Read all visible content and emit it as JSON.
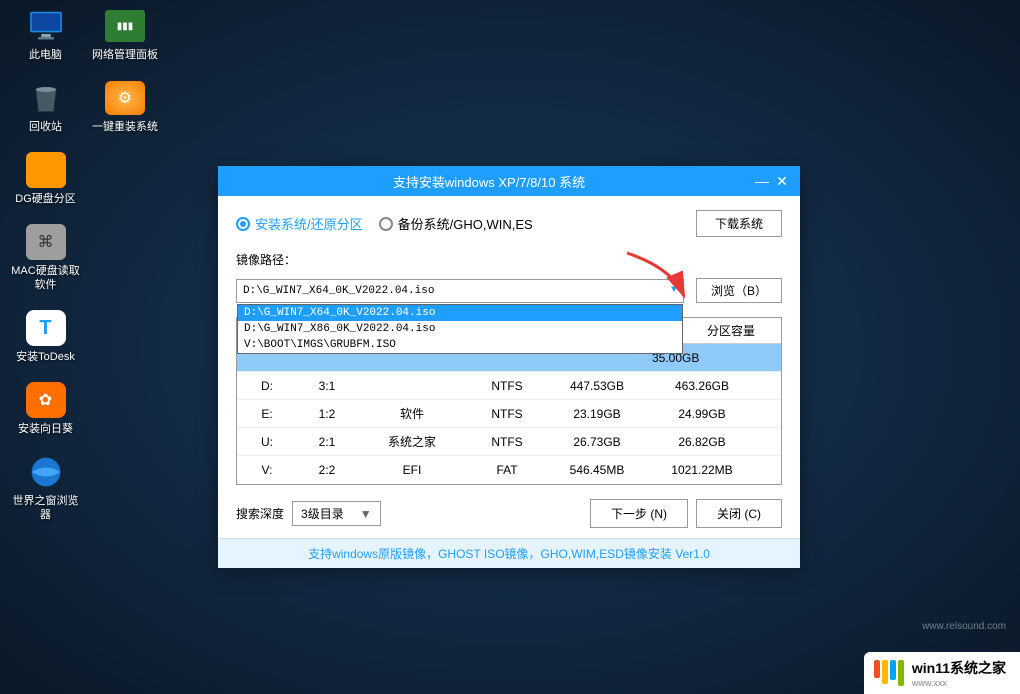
{
  "desktop": {
    "icons_col1": [
      {
        "label": "此电脑",
        "kind": "pc"
      },
      {
        "label": "回收站",
        "kind": "bin"
      },
      {
        "label": "DG硬盘分区",
        "kind": "dg"
      },
      {
        "label": "MAC硬盘读取软件",
        "kind": "mac"
      },
      {
        "label": "安装ToDesk",
        "kind": "todesk"
      },
      {
        "label": "安装向日葵",
        "kind": "sunflower"
      },
      {
        "label": "世界之窗浏览器",
        "kind": "globe"
      }
    ],
    "icons_col2": [
      {
        "label": "网络管理面板",
        "kind": "net"
      },
      {
        "label": "一键重装系统",
        "kind": "gear"
      }
    ]
  },
  "window": {
    "title": "支持安装windows XP/7/8/10 系统",
    "radio_install": "安装系统/还原分区",
    "radio_backup": "备份系统/GHO,WIN,ES",
    "download_btn": "下载系统",
    "image_path_label": "镜像路径：",
    "combo_value": "D:\\G_WIN7_X64_0K_V2022.04.iso",
    "browse_btn": "浏览（B）",
    "dropdown": [
      "D:\\G_WIN7_X64_0K_V2022.04.iso",
      "D:\\G_WIN7_X86_0K_V2022.04.iso",
      "V:\\BOOT\\IMGS\\GRUBFM.ISO"
    ],
    "table_header_truncated": "分区容量",
    "selected_row_free": "35.00GB",
    "rows": [
      {
        "drv": "D:",
        "num": "3:1",
        "lbl": "",
        "fs": "NTFS",
        "free": "447.53GB",
        "cap": "463.26GB"
      },
      {
        "drv": "E:",
        "num": "1:2",
        "lbl": "软件",
        "fs": "NTFS",
        "free": "23.19GB",
        "cap": "24.99GB"
      },
      {
        "drv": "U:",
        "num": "2:1",
        "lbl": "系统之家",
        "fs": "NTFS",
        "free": "26.73GB",
        "cap": "26.82GB"
      },
      {
        "drv": "V:",
        "num": "2:2",
        "lbl": "EFI",
        "fs": "FAT",
        "free": "546.45MB",
        "cap": "1021.22MB"
      }
    ],
    "search_depth_label": "搜索深度",
    "search_depth_value": "3级目录",
    "next_btn": "下一步 (N)",
    "close_btn": "关闭 (C)",
    "footer": "支持windows原版镜像，GHOST ISO镜像，GHO,WIM,ESD镜像安装 Ver1.0"
  },
  "watermarks": {
    "right_text": "win11系统之家",
    "right_sub": "www.xxx",
    "left_text": "www.relsound.com"
  }
}
